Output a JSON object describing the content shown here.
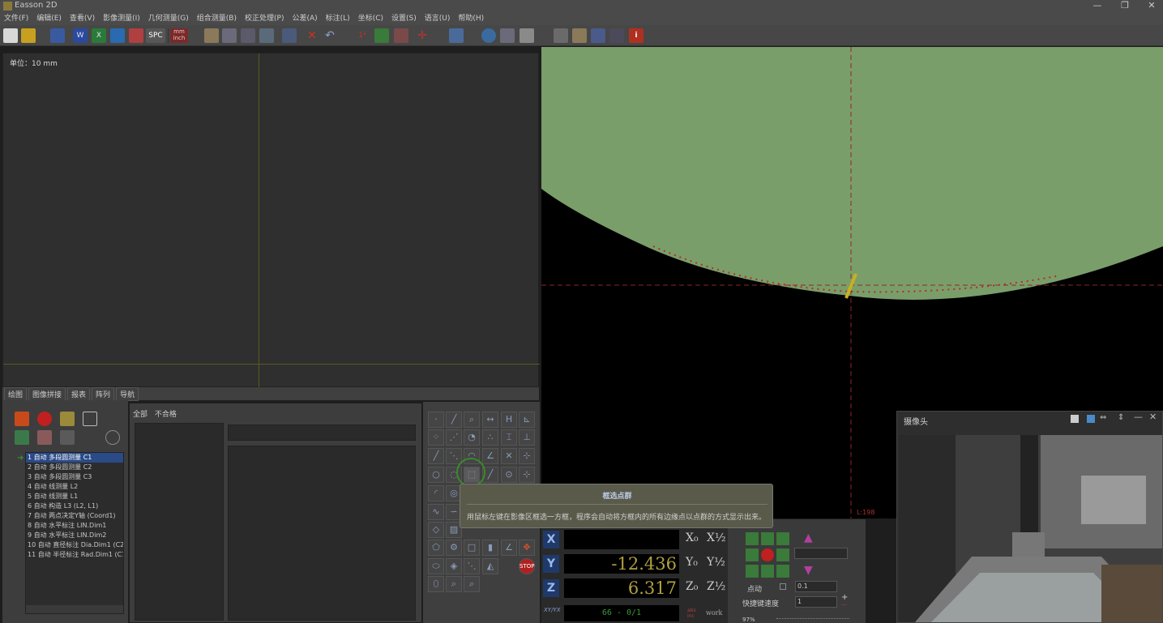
{
  "app": {
    "title": "Easson 2D"
  },
  "window_controls": [
    "—",
    "❐",
    "✕"
  ],
  "menu": [
    "文件(F)",
    "编辑(E)",
    "查看(V)",
    "影像测量(I)",
    "几何测量(G)",
    "组合测量(B)",
    "校正处理(P)",
    "公差(A)",
    "标注(L)",
    "坐标(C)",
    "设置(S)",
    "语言(U)",
    "帮助(H)"
  ],
  "toolbar": {
    "spc_label": "SPC",
    "mm_label": "mm",
    "inch_label": "inch"
  },
  "graph": {
    "unit_label": "单位：10 mm"
  },
  "bottom_tabs": [
    "绘图",
    "图像拼接",
    "报表",
    "阵列",
    "导航"
  ],
  "steps": [
    "1 自动 多段圆测量 C1",
    "2 自动 多段圆测量 C2",
    "3 自动 多段圆测量 C3",
    "4 自动 线测量 L2",
    "5 自动 线测量 L1",
    "6 自动 构造 L3 (L2, L1)",
    "7 自动 两点决定Y轴 (Coord1)",
    "8 自动 水平标注 LIN.Dim1",
    "9 自动 水平标注 LIN.Dim2",
    "10 自动 直径标注 Dia.Dim1 (C2",
    "11 自动 半径标注 Rad.Dim1 (C1"
  ],
  "filter": {
    "tab_all": "全部",
    "tab_fail": "不合格"
  },
  "tooltip": {
    "title": "框选点群",
    "body": "用鼠标左键在影像区框选一方框，程序会自动将方框内的所有边缘点以点群的方式显示出来。"
  },
  "camera_overlay": {
    "label": "L:198"
  },
  "dro": {
    "x_label": "X",
    "y_label": "Y",
    "z_label": "Z",
    "x_value": "",
    "y_value": "-12.436",
    "z_value": "6.317",
    "zero_x": "X₀",
    "zero_y": "Y₀",
    "zero_z": "Z₀",
    "half_x": "X½",
    "half_y": "Y½",
    "half_z": "Z½",
    "xy_label": "XY/YX",
    "status": "66 - 0/1",
    "abs_label": "abs inc",
    "work_label": "work"
  },
  "motion": {
    "jog_label": "点动",
    "jog_value": "0.1",
    "speed_label": "快捷键速度",
    "speed_value": "1",
    "plus": "+",
    "minus": "—",
    "percent": "97%"
  },
  "popup": {
    "title": "摄像头"
  },
  "colors": {
    "accent_blue": "#2a4a88",
    "camera_green": "#7a9e6a",
    "measure_red": "#c0302a",
    "cursor_yellow": "#c8b020"
  }
}
